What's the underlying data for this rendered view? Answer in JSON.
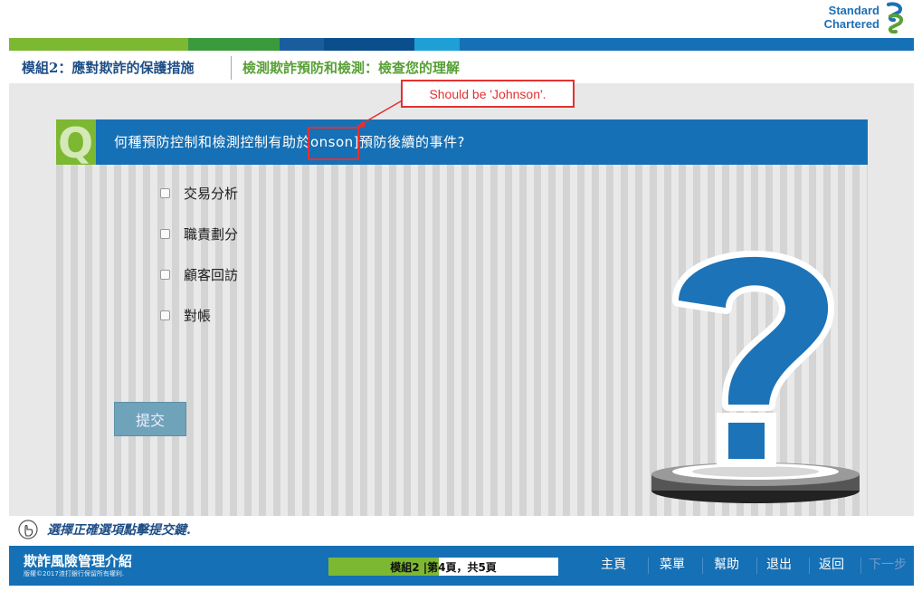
{
  "logo": {
    "line1": "Standard",
    "line2": "Chartered"
  },
  "strip_colors": [
    "#7cb832",
    "#3b9a3c",
    "#1a5d9e",
    "#0b4e8c",
    "#1e9fd6",
    "#1670b5"
  ],
  "header": {
    "module_title": "模組2：應對欺詐的保護措施",
    "section_title": "檢測欺詐預防和檢測：檢查您的理解"
  },
  "question": {
    "badge": "Q",
    "text": "何種預防控制和檢測控制有助於onson]預防後續的事件?"
  },
  "options": [
    {
      "label": "交易分析"
    },
    {
      "label": "職責劃分"
    },
    {
      "label": "顧客回訪"
    },
    {
      "label": "對帳"
    }
  ],
  "submit_label": "提交",
  "annotation": {
    "text": "Should be 'Johnson'."
  },
  "instruction": "選擇正確選項點擊提交鍵.",
  "footer": {
    "course_title": "欺詐風險管理介紹",
    "copyright": "版權©2017渣打銀行保留所有權利.",
    "progress_text": "模組2 |第4頁，共5頁",
    "progress_fraction": 0.48,
    "nav": {
      "home": "主頁",
      "menu": "菜單",
      "help": "幫助",
      "exit": "退出",
      "back": "返回",
      "next": "下一步"
    }
  },
  "colors": {
    "brand_blue": "#1670b5",
    "brand_green": "#7cb832",
    "annotation_red": "#e53030"
  }
}
